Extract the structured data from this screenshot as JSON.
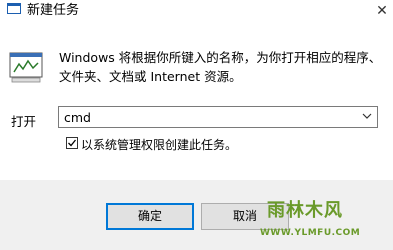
{
  "window": {
    "title": "新建任务",
    "close_glyph": "✕"
  },
  "description": {
    "line1": "Windows 将根据你所键入的名称，为你打开相应的程序、",
    "line2": "文件夹、文档或 Internet 资源。"
  },
  "open": {
    "label": "打开",
    "value": "cmd"
  },
  "admin_checkbox": {
    "checked": true,
    "label": "以系统管理权限创建此任务。"
  },
  "buttons": {
    "ok": "确定",
    "cancel": "取消"
  },
  "watermark": {
    "text": "雨林木风",
    "url": "WWW.YLMFU.COM"
  },
  "colors": {
    "focus_border": "#0078d7",
    "footer_bg": "#f0f0f0",
    "watermark": "#6a9a2a"
  }
}
